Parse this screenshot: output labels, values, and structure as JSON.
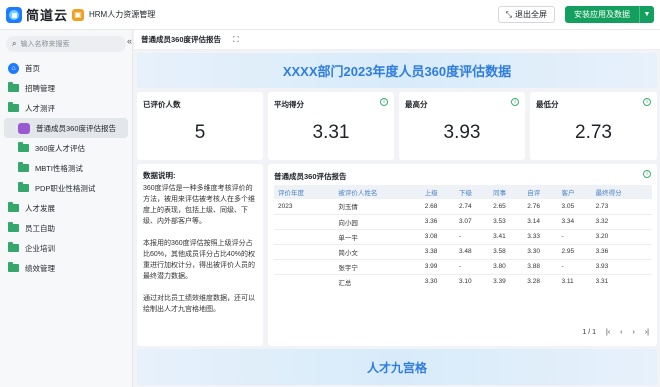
{
  "brand": {
    "name": "简道云"
  },
  "app": {
    "name": "HRM人力资源管理"
  },
  "toolbar": {
    "exit_fullscreen": "退出全屏",
    "install_label": "安装应用及数据"
  },
  "search": {
    "placeholder": "输入名称来搜索"
  },
  "sidebar": {
    "items": [
      {
        "label": "首页"
      },
      {
        "label": "招聘管理"
      },
      {
        "label": "人才测评"
      },
      {
        "label": "普通成员360度评估报告"
      },
      {
        "label": "360度人才评估"
      },
      {
        "label": "MBTI性格测试"
      },
      {
        "label": "PDP职业性格测试"
      },
      {
        "label": "人才发展"
      },
      {
        "label": "员工自助"
      },
      {
        "label": "企业培训"
      },
      {
        "label": "绩效管理"
      }
    ]
  },
  "page": {
    "title": "普通成员360度评估报告"
  },
  "banner": {
    "title": "XXXX部门2023年度人员360度评估数据"
  },
  "stats": [
    {
      "label": "已评价人数",
      "value": "5"
    },
    {
      "label": "平均得分",
      "value": "3.31"
    },
    {
      "label": "最高分",
      "value": "3.93"
    },
    {
      "label": "最低分",
      "value": "2.73"
    }
  ],
  "description": {
    "heading": "数据说明:",
    "p1": "360度评估是一种多维度考核评价的方法，被用来评估被考核人在多个维度上的表现，包括上级、同级、下级、内外部客户等。",
    "p2": "本报用的360度评估按照上级评分占比60%，其他成员评分占比40%的权重进行加权计分，得出被评价人员的最终潜力数据。",
    "p3": "通过对比员工绩效维度数据，还可以绘制出人才九宫格地图。"
  },
  "table": {
    "title": "普通成员360评估报告",
    "headers": [
      "评价年度",
      "被评价人姓名",
      "上级",
      "下级",
      "同事",
      "自评",
      "客户",
      "最终得分"
    ],
    "rows": [
      [
        "2023",
        "刘玉倩",
        "2.68",
        "2.74",
        "2.65",
        "2.76",
        "3.05",
        "2.73"
      ],
      [
        "",
        "向小园",
        "3.36",
        "3.07",
        "3.53",
        "3.14",
        "3.34",
        "3.32"
      ],
      [
        "",
        "单一平",
        "3.08",
        "-",
        "3.41",
        "3.33",
        "-",
        "3.20"
      ],
      [
        "",
        "简小文",
        "3.38",
        "3.48",
        "3.58",
        "3.30",
        "2.95",
        "3.36"
      ],
      [
        "",
        "张宇宁",
        "3.99",
        "-",
        "3.80",
        "3.88",
        "-",
        "3.93"
      ],
      [
        "",
        "汇总",
        "3.30",
        "3.10",
        "3.39",
        "3.28",
        "3.11",
        "3.31"
      ]
    ],
    "pager": "1 / 1"
  },
  "bottom_banner": {
    "title": "人才九宫格"
  }
}
